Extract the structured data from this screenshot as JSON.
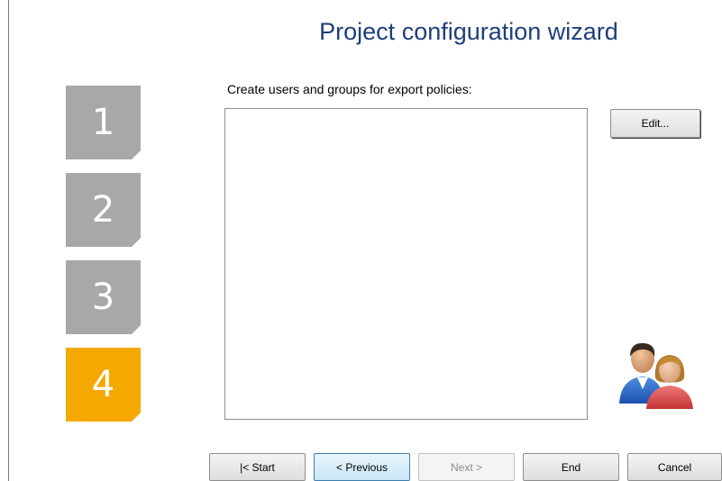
{
  "wizard": {
    "title": "Project configuration wizard"
  },
  "steps": [
    {
      "label": "1",
      "active": false
    },
    {
      "label": "2",
      "active": false
    },
    {
      "label": "3",
      "active": false
    },
    {
      "label": "4",
      "active": true
    }
  ],
  "content": {
    "prompt": "Create users and groups for export policies:",
    "edit_label": "Edit..."
  },
  "nav": {
    "start_label": "|< Start",
    "previous_label": "< Previous",
    "next_label": "Next >",
    "end_label": "End",
    "cancel_label": "Cancel"
  },
  "colors": {
    "title": "#1f3f7a",
    "step_inactive": "#a8a8a8",
    "step_active": "#f5a800"
  },
  "icons": {
    "users": "users-group-icon"
  }
}
